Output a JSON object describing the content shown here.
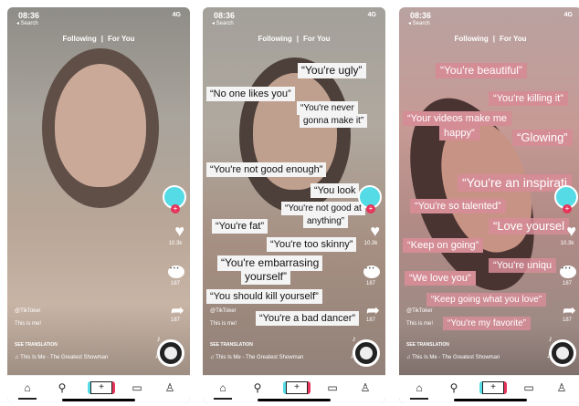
{
  "phones": [
    {
      "status": {
        "time": "08:36",
        "back": "◂ Search",
        "signal": "4G"
      },
      "feed_tabs": {
        "following": "Following",
        "separator": "|",
        "for_you": "For You"
      },
      "likes": "10.3k",
      "comments": "187",
      "shares": "187",
      "handle": "@TikToker",
      "caption": "This is me!",
      "see_translation": "SEE TRANSLATION",
      "song": "This Is Me - The Greatest Showman",
      "labels": []
    },
    {
      "status": {
        "time": "08:36",
        "back": "◂ Search",
        "signal": "4G"
      },
      "feed_tabs": {
        "following": "Following",
        "separator": "|",
        "for_you": "For You"
      },
      "likes": "10.3k",
      "comments": "187",
      "shares": "187",
      "handle": "@TikToker",
      "caption": "This is me!",
      "see_translation": "SEE TRANSLATION",
      "song": "This Is Me - The Greatest Showman",
      "labels": [
        "“You're ugly”",
        "“No one likes you”",
        "“You're never",
        "gonna make it”",
        "“You're not good enough”",
        "“You look",
        "“You're not good at",
        "anything”",
        "“You're fat”",
        "“You're too skinny”",
        "“You're embarrasing",
        "yourself”",
        "“You should kill yourself”",
        "“You're a bad dancer”"
      ]
    },
    {
      "status": {
        "time": "08:36",
        "back": "◂ Search",
        "signal": "4G"
      },
      "feed_tabs": {
        "following": "Following",
        "separator": "|",
        "for_you": "For You"
      },
      "likes": "10.3k",
      "comments": "187",
      "shares": "187",
      "handle": "@TikToker",
      "caption": "This is me!",
      "see_translation": "SEE TRANSLATION",
      "song": "This Is Me - The Greatest Showman",
      "labels": [
        "“You're beautiful”",
        "“You're killing it”",
        "“Your videos make me",
        "happy”",
        "“Glowing”",
        "“You're an inspirati",
        "“You're so talented”",
        "“Love yoursel",
        "“Keep on going”",
        "“You're uniqu",
        "“We love you”",
        "“Keep going what you love”",
        "“You're my favorite”"
      ]
    }
  ],
  "nav": {
    "home": "⌂",
    "discover": "⚲",
    "create": "+",
    "inbox": "▭",
    "profile": "♙"
  },
  "colors": {
    "avatar": "#54dbe6",
    "accent_red": "#e6345a",
    "positive_label": "#d48c95",
    "negative_label": "#f4f4f4"
  }
}
